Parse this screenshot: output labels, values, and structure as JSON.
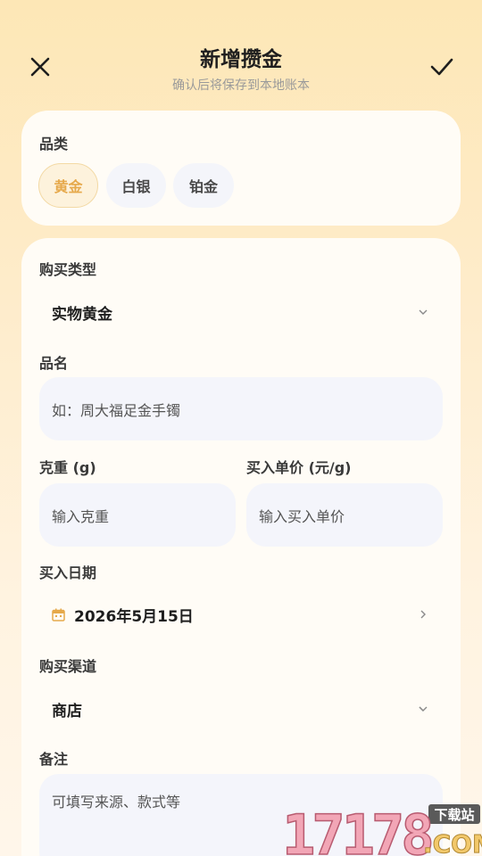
{
  "header": {
    "title": "新增攒金",
    "subtitle": "确认后将保存到本地账本",
    "close_icon": "close-icon",
    "confirm_icon": "check-icon"
  },
  "category": {
    "label": "品类",
    "chips": [
      {
        "label": "黄金",
        "selected": true
      },
      {
        "label": "白银",
        "selected": false
      },
      {
        "label": "铂金",
        "selected": false
      }
    ]
  },
  "form": {
    "purchase_type": {
      "label": "购买类型",
      "value": "实物黄金"
    },
    "product_name": {
      "label": "品名",
      "placeholder": "如：周大福足金手镯"
    },
    "weight": {
      "label": "克重 (g)",
      "placeholder": "输入克重"
    },
    "unit_price": {
      "label": "买入单价 (元/g)",
      "placeholder": "输入买入单价"
    },
    "purchase_date": {
      "label": "买入日期",
      "value": "2026年5月15日"
    },
    "channel": {
      "label": "购买渠道",
      "value": "商店"
    },
    "notes": {
      "label": "备注",
      "placeholder": "可填写来源、款式等"
    }
  },
  "watermark": {
    "number": "17178",
    "tag": "下载站",
    "suffix": ".COM"
  },
  "colors": {
    "accent": "#e6a94b",
    "chip_selected_bg": "#fdf2dc",
    "input_bg": "#f4f5fb"
  }
}
